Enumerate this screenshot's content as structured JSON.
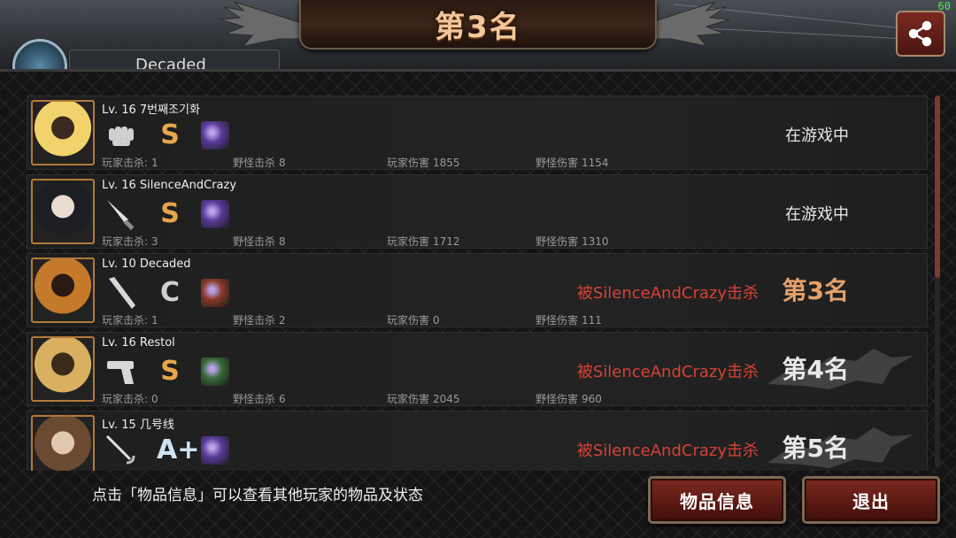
{
  "fps": "60",
  "title": "第3名",
  "profile": {
    "name": "Decaded"
  },
  "players": [
    {
      "level": "Lv. 16",
      "name": "7번째조기화",
      "grade": "S",
      "grade_class": "grade-S",
      "weapon": "fist-icon",
      "item_color": "#5a3b9a",
      "kills_label": "玩家击杀:",
      "kills": "1",
      "mob_label": "野怪击杀",
      "mob_kills": "8",
      "pdmg_label": "玩家伤害",
      "pdmg": "1855",
      "mdmg_label": "野怪伤害",
      "mdmg": "1154",
      "status": "在游戏中",
      "killed_by": "",
      "rank": ""
    },
    {
      "level": "Lv. 16",
      "name": "SilenceAndCrazy",
      "grade": "S",
      "grade_class": "grade-S",
      "weapon": "knife-icon",
      "item_color": "#5a3b9a",
      "kills_label": "玩家击杀:",
      "kills": "3",
      "mob_label": "野怪击杀",
      "mob_kills": "8",
      "pdmg_label": "玩家伤害",
      "pdmg": "1712",
      "mdmg_label": "野怪伤害",
      "mdmg": "1310",
      "status": "在游戏中",
      "killed_by": "",
      "rank": ""
    },
    {
      "level": "Lv. 10",
      "name": "Decaded",
      "grade": "C",
      "grade_class": "grade-C",
      "weapon": "bat-icon",
      "item_color": "#8a3a2a",
      "kills_label": "玩家击杀:",
      "kills": "1",
      "mob_label": "野怪击杀",
      "mob_kills": "2",
      "pdmg_label": "玩家伤害",
      "pdmg": "0",
      "mdmg_label": "野怪伤害",
      "mdmg": "111",
      "status": "",
      "killed_by": "被SilenceAndCrazy击杀",
      "rank": "第3名"
    },
    {
      "level": "Lv. 16",
      "name": "Restol",
      "grade": "S",
      "grade_class": "grade-S",
      "weapon": "pistol-icon",
      "item_color": "#3a6a3a",
      "kills_label": "玩家击杀:",
      "kills": "0",
      "mob_label": "野怪击杀",
      "mob_kills": "6",
      "pdmg_label": "玩家伤害",
      "pdmg": "2045",
      "mdmg_label": "野怪伤害",
      "mdmg": "960",
      "status": "",
      "killed_by": "被SilenceAndCrazy击杀",
      "rank": "第4名"
    },
    {
      "level": "Lv. 15",
      "name": "几号线",
      "grade": "A+",
      "grade_class": "grade-A",
      "weapon": "rapier-icon",
      "item_color": "#5a3b9a",
      "kills_label": "",
      "kills": "",
      "mob_label": "",
      "mob_kills": "",
      "pdmg_label": "",
      "pdmg": "",
      "mdmg_label": "",
      "mdmg": "",
      "status": "",
      "killed_by": "被SilenceAndCrazy击杀",
      "rank": "第5名"
    }
  ],
  "footer": {
    "hint": "点击「物品信息」可以查看其他玩家的物品及状态",
    "items_button": "物品信息",
    "exit_button": "退出"
  }
}
